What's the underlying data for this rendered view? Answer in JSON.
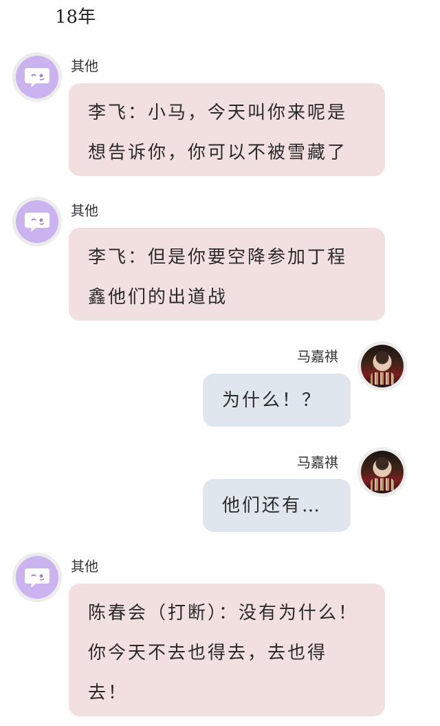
{
  "header": {
    "year": "18年"
  },
  "messages": [
    {
      "sender": "其他",
      "text": "李飞：小马，今天叫你来呢是想告诉你，你可以不被雪藏了"
    },
    {
      "sender": "其他",
      "text": "李飞：但是你要空降参加丁程鑫他们的出道战"
    },
    {
      "sender": "马嘉祺",
      "text": "为什么！？"
    },
    {
      "sender": "马嘉祺",
      "text": "他们还有…"
    },
    {
      "sender": "其他",
      "text": "陈春会（打断）：没有为什么！你今天不去也得去，去也得去！"
    }
  ],
  "colors": {
    "other_bubble": "#f2dfe0",
    "self_bubble": "#e0e6ee",
    "other_avatar": "#cbb3ef"
  },
  "icons": {
    "other_avatar": "chat-bubble-icon",
    "self_avatar": "user-photo"
  }
}
